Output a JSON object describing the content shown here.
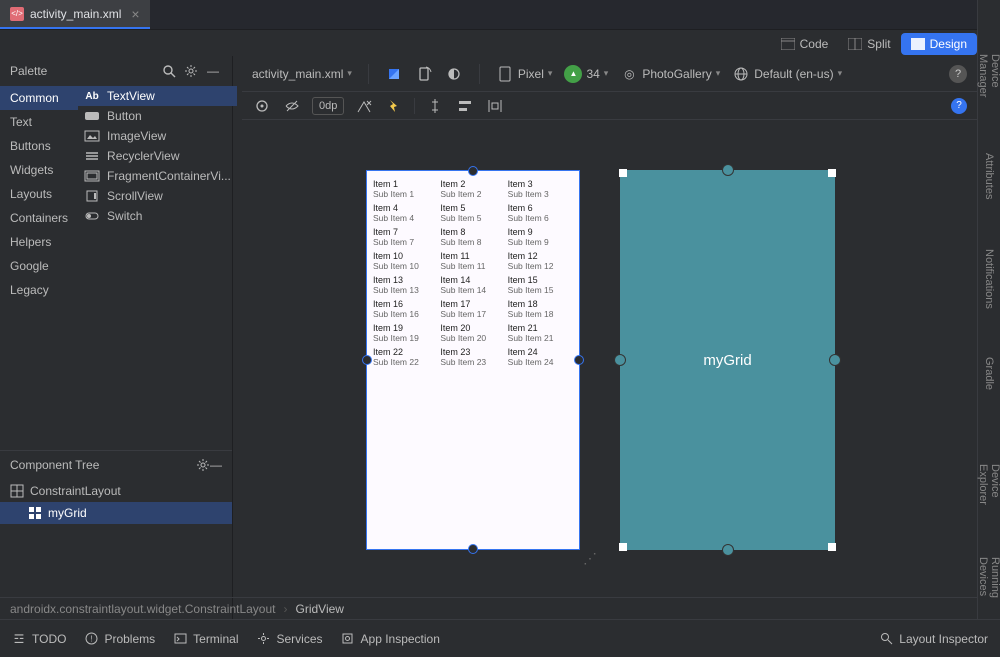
{
  "tab": {
    "filename": "activity_main.xml"
  },
  "views": {
    "code": "Code",
    "split": "Split",
    "design": "Design"
  },
  "toolbar": {
    "file": "activity_main.xml",
    "device": "Pixel",
    "apiLevel": "34",
    "app": "PhotoGallery",
    "locale": "Default (en-us)"
  },
  "designbar": {
    "dp": "0dp"
  },
  "palette": {
    "title": "Palette",
    "categories": [
      "Common",
      "Text",
      "Buttons",
      "Widgets",
      "Layouts",
      "Containers",
      "Helpers",
      "Google",
      "Legacy"
    ],
    "activeCategory": "Common",
    "items": [
      "TextView",
      "Button",
      "ImageView",
      "RecyclerView",
      "FragmentContainerVi...",
      "ScrollView",
      "Switch"
    ],
    "selectedItem": "TextView"
  },
  "componentTree": {
    "title": "Component Tree",
    "root": "ConstraintLayout",
    "child": "myGrid"
  },
  "preview": {
    "gridLabel": "myGrid",
    "items": [
      {
        "t": "Item 1",
        "s": "Sub Item 1"
      },
      {
        "t": "Item 2",
        "s": "Sub Item 2"
      },
      {
        "t": "Item 3",
        "s": "Sub Item 3"
      },
      {
        "t": "Item 4",
        "s": "Sub Item 4"
      },
      {
        "t": "Item 5",
        "s": "Sub Item 5"
      },
      {
        "t": "Item 6",
        "s": "Sub Item 6"
      },
      {
        "t": "Item 7",
        "s": "Sub Item 7"
      },
      {
        "t": "Item 8",
        "s": "Sub Item 8"
      },
      {
        "t": "Item 9",
        "s": "Sub Item 9"
      },
      {
        "t": "Item 10",
        "s": "Sub Item 10"
      },
      {
        "t": "Item 11",
        "s": "Sub Item 11"
      },
      {
        "t": "Item 12",
        "s": "Sub Item 12"
      },
      {
        "t": "Item 13",
        "s": "Sub Item 13"
      },
      {
        "t": "Item 14",
        "s": "Sub Item 14"
      },
      {
        "t": "Item 15",
        "s": "Sub Item 15"
      },
      {
        "t": "Item 16",
        "s": "Sub Item 16"
      },
      {
        "t": "Item 17",
        "s": "Sub Item 17"
      },
      {
        "t": "Item 18",
        "s": "Sub Item 18"
      },
      {
        "t": "Item 19",
        "s": "Sub Item 19"
      },
      {
        "t": "Item 20",
        "s": "Sub Item 20"
      },
      {
        "t": "Item 21",
        "s": "Sub Item 21"
      },
      {
        "t": "Item 22",
        "s": "Sub Item 22"
      },
      {
        "t": "Item 23",
        "s": "Sub Item 23"
      },
      {
        "t": "Item 24",
        "s": "Sub Item 24"
      }
    ]
  },
  "breadcrumb": {
    "a": "androidx.constraintlayout.widget.ConstraintLayout",
    "b": "GridView"
  },
  "bottombar": {
    "todo": "TODO",
    "problems": "Problems",
    "terminal": "Terminal",
    "services": "Services",
    "appInspection": "App Inspection",
    "layoutInspector": "Layout Inspector"
  },
  "rightRail": {
    "deviceManager": "Device Manager",
    "attributes": "Attributes",
    "notifications": "Notifications",
    "gradle": "Gradle",
    "deviceExplorer": "Device Explorer",
    "runningDevices": "Running Devices"
  }
}
